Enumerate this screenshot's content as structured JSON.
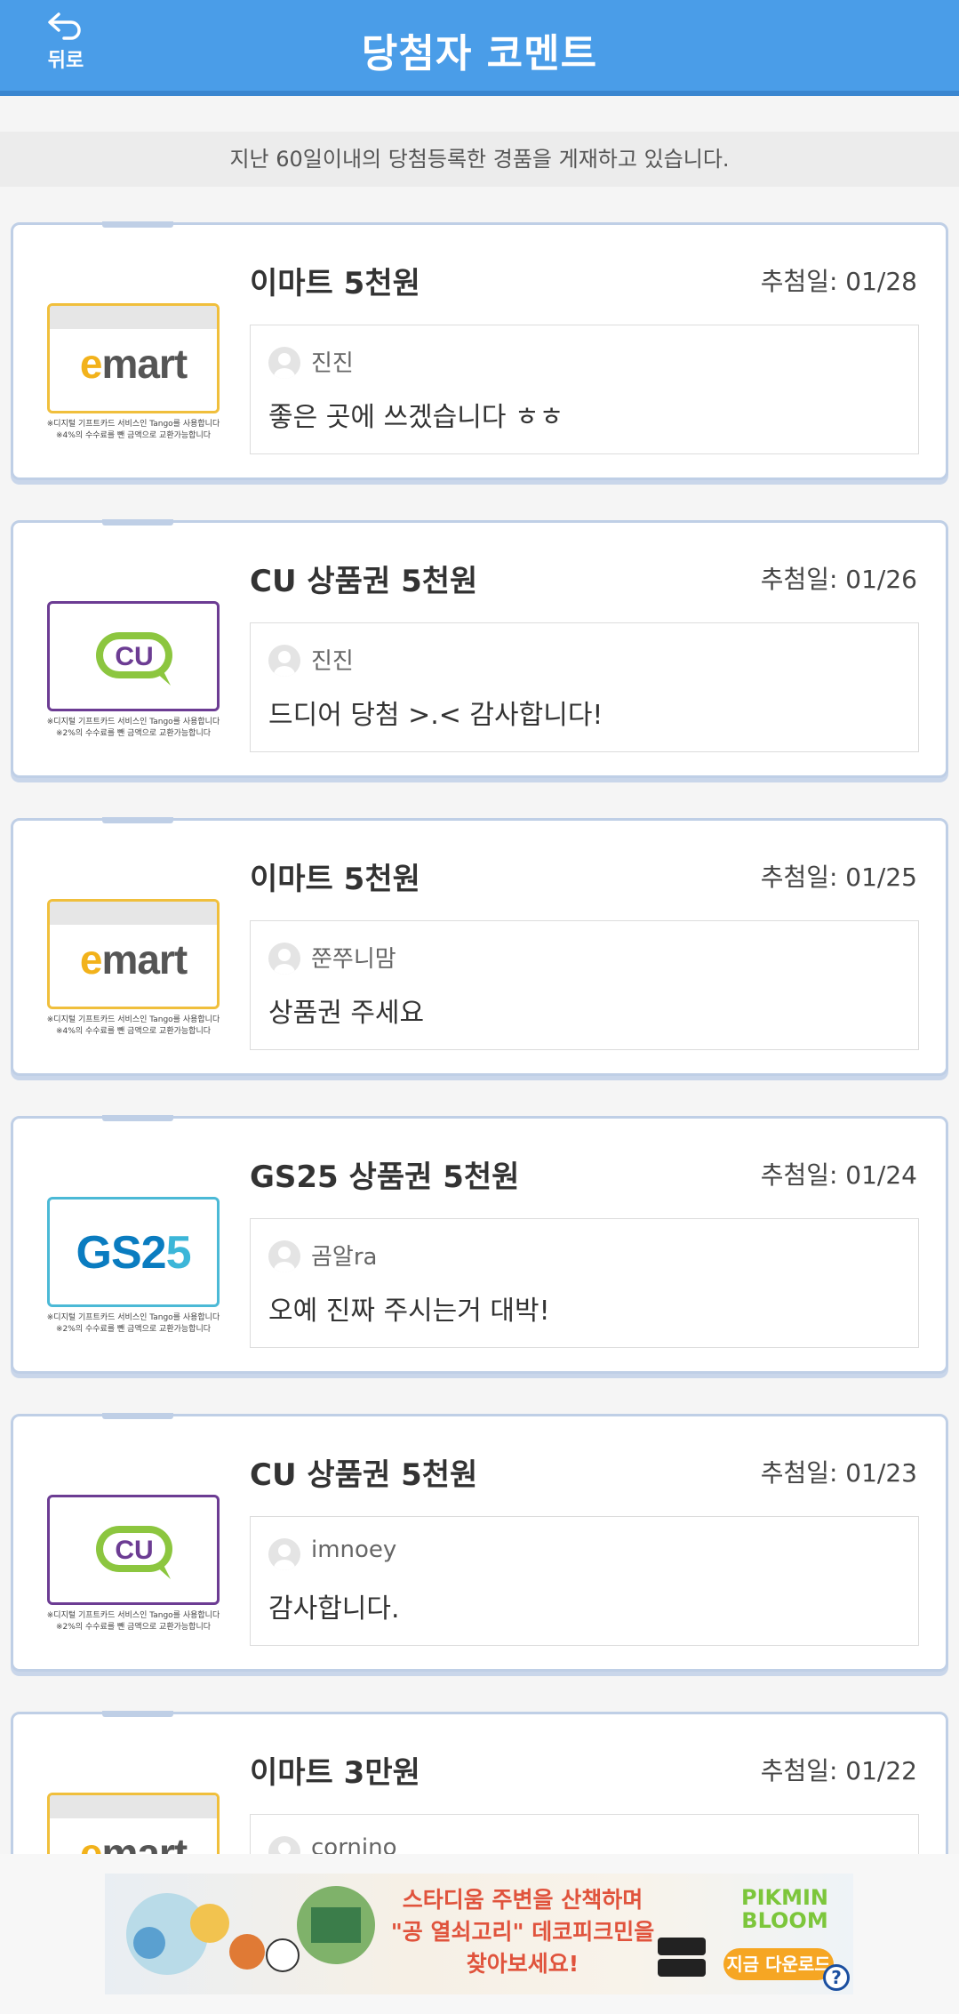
{
  "header": {
    "back_label": "뒤로",
    "title": "당첨자 코멘트"
  },
  "notice": "지난 60일이내의 당첨등록한 경품을 게재하고 있습니다.",
  "winners": [
    {
      "prize": "이마트 5천원",
      "date_label": "추첨일: 01/28",
      "brand": "emart",
      "caption_1": "※디지털 기프트카드 서비스인 Tango를 사용합니다",
      "caption_2": "※4%의 수수료를 뺀 금액으로 교환가능합니다",
      "user": "진진",
      "comment": "좋은 곳에 쓰겠습니다 ㅎㅎ"
    },
    {
      "prize": "CU 상품권 5천원",
      "date_label": "추첨일: 01/26",
      "brand": "CU",
      "caption_1": "※디지털 기프트카드 서비스인 Tango를 사용합니다",
      "caption_2": "※2%의 수수료를 뺀 금액으로 교환가능합니다",
      "user": "진진",
      "comment": "드디어 당첨 >.< 감사합니다!"
    },
    {
      "prize": "이마트 5천원",
      "date_label": "추첨일: 01/25",
      "brand": "emart",
      "caption_1": "※디지털 기프트카드 서비스인 Tango를 사용합니다",
      "caption_2": "※4%의 수수료를 뺀 금액으로 교환가능합니다",
      "user": "쭌쭈니맘",
      "comment": "상품권 주세요"
    },
    {
      "prize": "GS25 상품권 5천원",
      "date_label": "추첨일: 01/24",
      "brand": "GS25",
      "caption_1": "※디지털 기프트카드 서비스인 Tango를 사용합니다",
      "caption_2": "※2%의 수수료를 뺀 금액으로 교환가능합니다",
      "user": "곰알ra",
      "comment": "오예 진짜 주시는거 대박!"
    },
    {
      "prize": "CU 상품권 5천원",
      "date_label": "추첨일: 01/23",
      "brand": "CU",
      "caption_1": "※디지털 기프트카드 서비스인 Tango를 사용합니다",
      "caption_2": "※2%의 수수료를 뺀 금액으로 교환가능합니다",
      "user": "imnoey",
      "comment": "감사합니다."
    },
    {
      "prize": "이마트 3만원",
      "date_label": "추첨일: 01/22",
      "brand": "emart",
      "caption_1": "",
      "caption_2": "",
      "user": "cornino",
      "comment": ""
    }
  ],
  "ad": {
    "headline_1": "스타디움 주변을 산책하며",
    "headline_2": "\"공 열쇠고리\" 데코피크민을",
    "headline_3": "찾아보세요!",
    "brand_1": "PIKMIN",
    "brand_2": "BLOOM",
    "cta": "지금 다운로드",
    "help": "?"
  },
  "colors": {
    "header": "#4a9de8",
    "card_border": "#bfcfe6",
    "emart_yellow": "#f2b21b",
    "cu_purple": "#6c3c93",
    "cu_green": "#8cc63f",
    "gs_blue": "#0a7cc0"
  }
}
